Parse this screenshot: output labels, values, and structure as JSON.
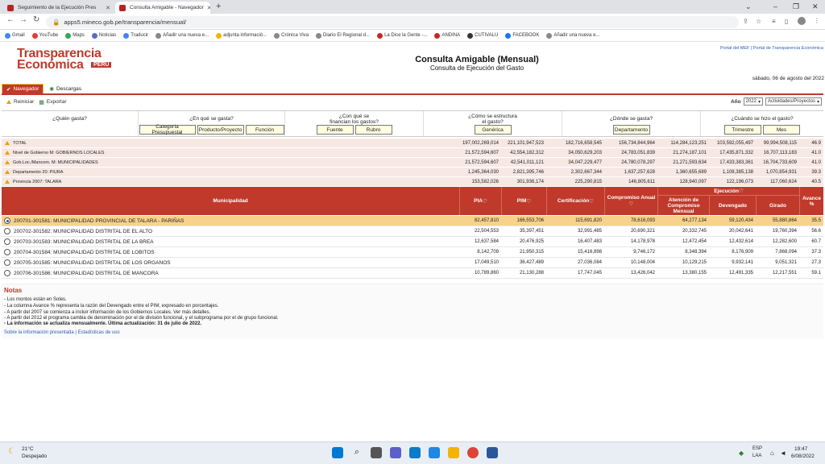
{
  "browser": {
    "tabs": [
      {
        "title": "Seguimiento de la Ejecución Pres"
      },
      {
        "title": "Consulta Amigable - Navegador"
      }
    ],
    "url": "apps5.mineco.gob.pe/transparencia/mensual/",
    "bookmarks": [
      "Gmail",
      "YouTube",
      "Maps",
      "Noticias",
      "Traducir",
      "Añadir una nueva e...",
      "adjunta informació...",
      "Crónica Viva",
      "Diario El Regional d...",
      "La Dice la Gente -...",
      "ANDINA",
      "CUTIVALU",
      "FACEBOOK",
      "Añadir una nueva e..."
    ]
  },
  "page": {
    "logo_line1": "Transparencia",
    "logo_line2": "Económica",
    "logo_badge": "PERU",
    "title": "Consulta Amigable (Mensual)",
    "subtitle": "Consulta de Ejecución del Gasto",
    "top_links": "Portal del MEF  |  Portal de Transparencia Económica",
    "date": "sábado, 06 de agosto del 2022",
    "tab_navegador": "Navegador",
    "tab_descargas": "Descargas",
    "reiniciar": "Reiniciar",
    "exportar": "Exportar",
    "anio_label": "Año",
    "anio_value": "2022",
    "actividades": "Actividades/Proyectos"
  },
  "questions": {
    "q1": "¿Quién gasta?",
    "q2": "¿En qué se gasta?",
    "q3a": "¿Con qué se",
    "q3b": "financian los gastos?",
    "q4a": "¿Cómo se estructura",
    "q4b": "el gasto?",
    "q5": "¿Dónde se gasta?",
    "q6": "¿Cuándo se hizo el gasto?",
    "b_categoria": "Categoría Presupuestal",
    "b_producto": "Producto/Proyecto",
    "b_funcion": "Función",
    "b_fuente": "Fuente",
    "b_rubro": "Rubro",
    "b_generica": "Genérica",
    "b_departamento": "Departamento",
    "b_trimestre": "Trimestre",
    "b_mes": "Mes"
  },
  "summary": [
    {
      "label": "TOTAL",
      "pia": "197,002,269,014",
      "pim": "221,101,947,523",
      "cert": "182,716,658,545",
      "comp": "156,734,844,964",
      "aten": "114,284,123,251",
      "dev": "103,592,055,497",
      "gir": "99,994,508,115",
      "av": "46.9"
    },
    {
      "label": "Nivel de Gobierno M: GOBIERNOS LOCALES",
      "pia": "21,572,594,607",
      "pim": "42,554,182,312",
      "cert": "34,050,629,203",
      "comp": "24,783,051,839",
      "aten": "21,274,187,101",
      "dev": "17,435,871,332",
      "gir": "16,707,113,183",
      "av": "41.0"
    },
    {
      "label": "Gob.Loc./Mancom. M: MUNICIPALIDADES",
      "pia": "21,572,594,607",
      "pim": "42,541,011,121",
      "cert": "34,047,229,477",
      "comp": "24,780,078,297",
      "aten": "21,271,593,634",
      "dev": "17,433,383,361",
      "gir": "16,704,733,609",
      "av": "41.0"
    },
    {
      "label": "Departamento 20: PIURA",
      "pia": "1,245,364,030",
      "pim": "2,821,395,746",
      "cert": "2,302,667,344",
      "comp": "1,637,257,628",
      "aten": "1,360,655,689",
      "dev": "1,108,385,138",
      "gir": "1,070,854,931",
      "av": "39.3"
    },
    {
      "label": "Provincia 2007: TALARA",
      "pia": "153,582,026",
      "pim": "301,936,174",
      "cert": "225,290,815",
      "comp": "146,805,611",
      "aten": "128,940,097",
      "dev": "122,196,073",
      "gir": "117,060,624",
      "av": "40.5"
    }
  ],
  "table": {
    "h_muni": "Municipalidad",
    "h_pia": "PIA",
    "h_pim": "PIM",
    "h_cert": "Certificación",
    "h_comp": "Compromiso Anual",
    "h_ejec": "Ejecución",
    "h_aten": "Atención de Compromiso Mensual",
    "h_dev": "Devengado",
    "h_gir": "Girado",
    "h_av": "Avance %",
    "rows": [
      {
        "name": "200701-301581: MUNICIPALIDAD PROVINCIAL DE TALARA - PARIÑAS",
        "pia": "82,457,810",
        "pim": "166,553,706",
        "cert": "115,691,820",
        "comp": "78,616,093",
        "aten": "64,277,134",
        "dev": "59,120,434",
        "gir": "55,880,864",
        "av": "35.5"
      },
      {
        "name": "200702-301582: MUNICIPALIDAD DISTRITAL DE EL ALTO",
        "pia": "22,504,553",
        "pim": "35,397,451",
        "cert": "32,991,485",
        "comp": "20,690,321",
        "aten": "20,332,745",
        "dev": "20,042,641",
        "gir": "19,760,394",
        "av": "56.6"
      },
      {
        "name": "200703-301583: MUNICIPALIDAD DISTRITAL DE LA BREA",
        "pia": "12,637,584",
        "pim": "20,476,925",
        "cert": "16,407,483",
        "comp": "14,178,978",
        "aten": "12,472,454",
        "dev": "12,432,614",
        "gir": "12,282,600",
        "av": "60.7"
      },
      {
        "name": "200704-301584: MUNICIPALIDAD DISTRITAL DE LOBITOS",
        "pia": "8,142,709",
        "pim": "21,950,315",
        "cert": "15,416,898",
        "comp": "9,746,172",
        "aten": "8,348,394",
        "dev": "8,176,909",
        "gir": "7,868,094",
        "av": "37.3"
      },
      {
        "name": "200705-301585: MUNICIPALIDAD DISTRITAL DE LOS ORGANOS",
        "pia": "17,049,510",
        "pim": "36,427,489",
        "cert": "27,036,084",
        "comp": "10,148,004",
        "aten": "10,129,215",
        "dev": "9,932,141",
        "gir": "9,051,321",
        "av": "27.3"
      },
      {
        "name": "200706-301586: MUNICIPALIDAD DISTRITAL DE MANCORA",
        "pia": "10,789,860",
        "pim": "21,130,288",
        "cert": "17,747,045",
        "comp": "13,426,042",
        "aten": "13,380,155",
        "dev": "12,491,335",
        "gir": "12,217,551",
        "av": "59.1"
      }
    ]
  },
  "notes": {
    "title": "Notas",
    "n1": "- Los montos están en Soles.",
    "n2": "- La columna Avance % representa la razón del Devengado entre el PIM, expresado en porcentajes.",
    "n3": "- A partir del 2007 se comienza a incluir información de los Gobiernos Locales. Ver más detalles.",
    "n4": "- A partir del 2012 el programa cambia de denominación por el de división funcional, y el subprograma por el de grupo funcional.",
    "n5": "- La información se actualiza mensualmente. Última actualización: 31 de julio de 2022.",
    "links": "Sobre la información presentada  |  Estadísticas de uso"
  },
  "taskbar": {
    "temp": "21°C",
    "weather": "Despejado",
    "lang1": "ESP",
    "lang2": "LAA",
    "time": "19:47",
    "date": "6/08/2022"
  }
}
